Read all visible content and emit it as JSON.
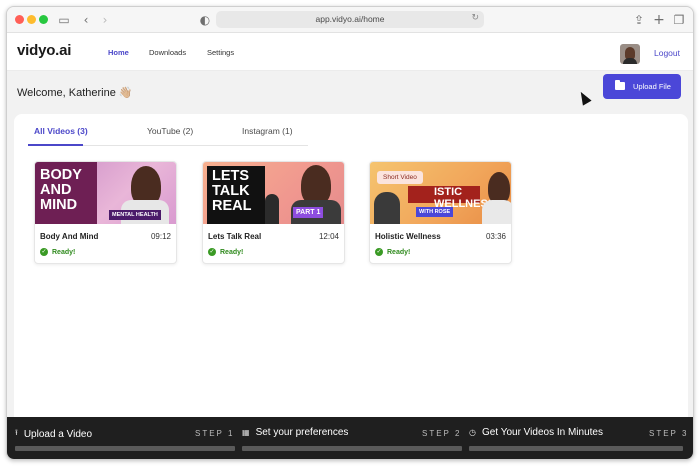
{
  "browser": {
    "url": "app.vidyo.ai/home"
  },
  "app": {
    "logo": "vidyo.ai",
    "nav": [
      "Home",
      "Downloads",
      "Settings"
    ],
    "logout": "Logout",
    "accent": "#4b47d8"
  },
  "welcome": {
    "text": "Welcome, Katherine 👋🏼",
    "upload_button": "Upload File"
  },
  "tabs": [
    {
      "label": "All Videos (3)",
      "active": true
    },
    {
      "label": "YouTube (2)",
      "active": false
    },
    {
      "label": "Instagram (1)",
      "active": false
    }
  ],
  "videos": [
    {
      "title": "Body And Mind",
      "duration": "09:12",
      "status": "Ready!",
      "thumb_text": "BODY AND MIND",
      "thumb_tag": "MENTAL HEALTH"
    },
    {
      "title": "Lets Talk Real",
      "duration": "12:04",
      "status": "Ready!",
      "thumb_text": "LETS TALK REAL",
      "thumb_tag": "PART 1"
    },
    {
      "title": "Holistic Wellness",
      "duration": "03:36",
      "status": "Ready!",
      "thumb_text": "ISTIC WELLNESS",
      "thumb_tag": "WITH ROSE",
      "badge": "Short Video"
    }
  ],
  "steps": [
    {
      "label": "Upload a Video",
      "step": "STEP 1",
      "icon": "upload-icon"
    },
    {
      "label": "Set your preferences",
      "step": "STEP 2",
      "icon": "grid-icon"
    },
    {
      "label": "Get Your Videos In Minutes",
      "step": "STEP 3",
      "icon": "clock-icon"
    }
  ]
}
